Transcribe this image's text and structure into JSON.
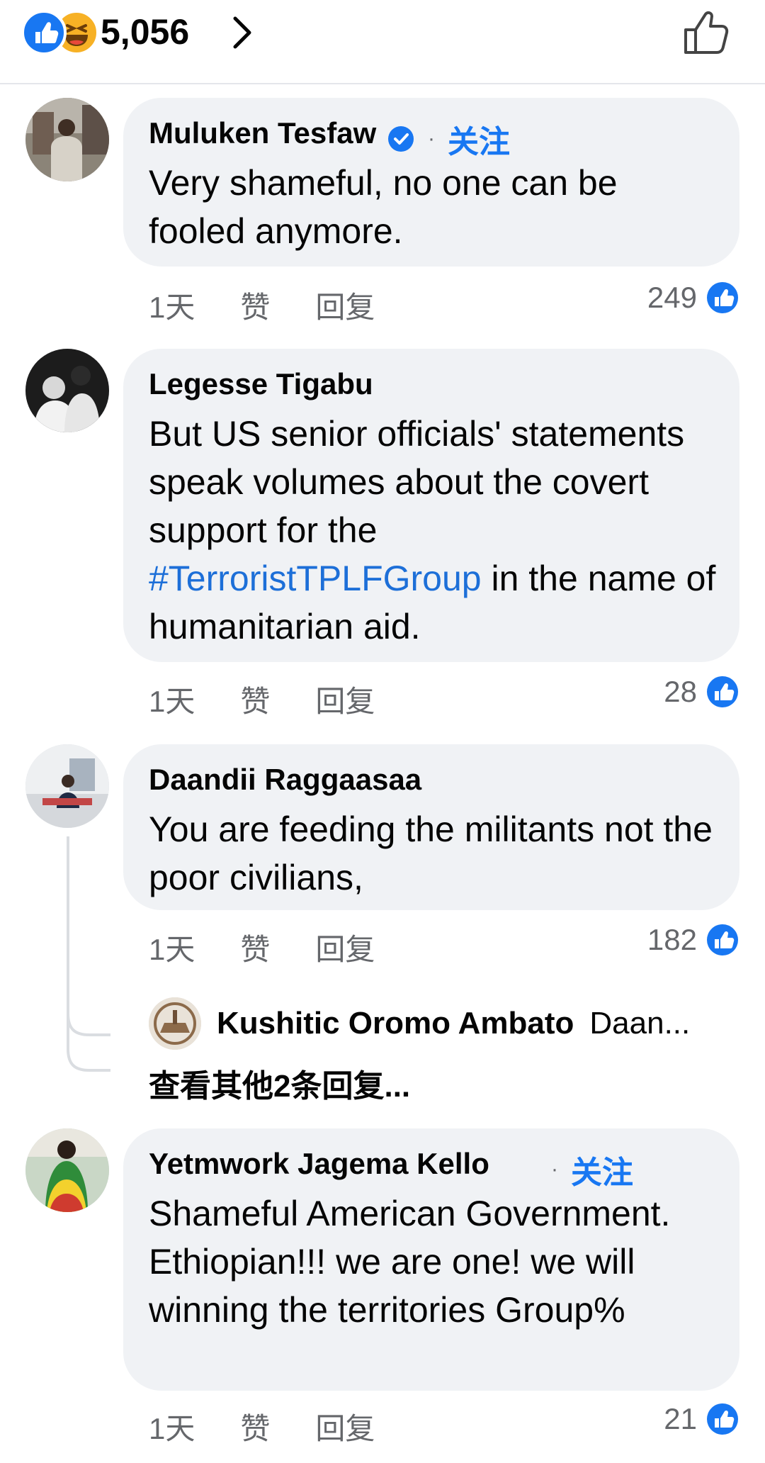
{
  "header": {
    "reaction_count": "5,056",
    "reaction_icons": [
      "like-icon",
      "haha-icon"
    ],
    "thumb_icon": "thumb-up-outline-icon"
  },
  "comments": [
    {
      "author": "Muluken Tesfaw",
      "verified": true,
      "follow_label": "关注",
      "separator": "·",
      "text": "Very shameful, no one can  be fooled anymore.",
      "time": "1天",
      "like_label": "赞",
      "reply_label": "回复",
      "likes": "249"
    },
    {
      "author": "Legesse Tigabu",
      "text_before": "But US senior officials' statements speak volumes about the covert support for the ",
      "hashtag": "#TerroristTPLFGroup",
      "text_after": " in the name of humanitarian aid.",
      "time": "1天",
      "like_label": "赞",
      "reply_label": "回复",
      "likes": "28"
    },
    {
      "author": "Daandii Raggaasaa",
      "text": "You are feeding the militants not the poor civilians,",
      "time": "1天",
      "like_label": "赞",
      "reply_label": "回复",
      "likes": "182",
      "reply_preview": {
        "author": "Kushitic Oromo Ambato",
        "snippet": "Daan..."
      },
      "more_replies": "查看其他2条回复..."
    },
    {
      "author": "Yetmwork Jagema Kello",
      "follow_label": "关注",
      "separator": "·",
      "text": "Shameful American Government. Ethiopian!!! we are one! we will winning the territories Group%",
      "time": "1天",
      "like_label": "赞",
      "reply_label": "回复",
      "likes": "21"
    }
  ],
  "colors": {
    "accent": "#1877f2",
    "bubble": "#f0f2f5",
    "secondary_text": "#65676b",
    "hashtag": "#1d6fd8"
  }
}
